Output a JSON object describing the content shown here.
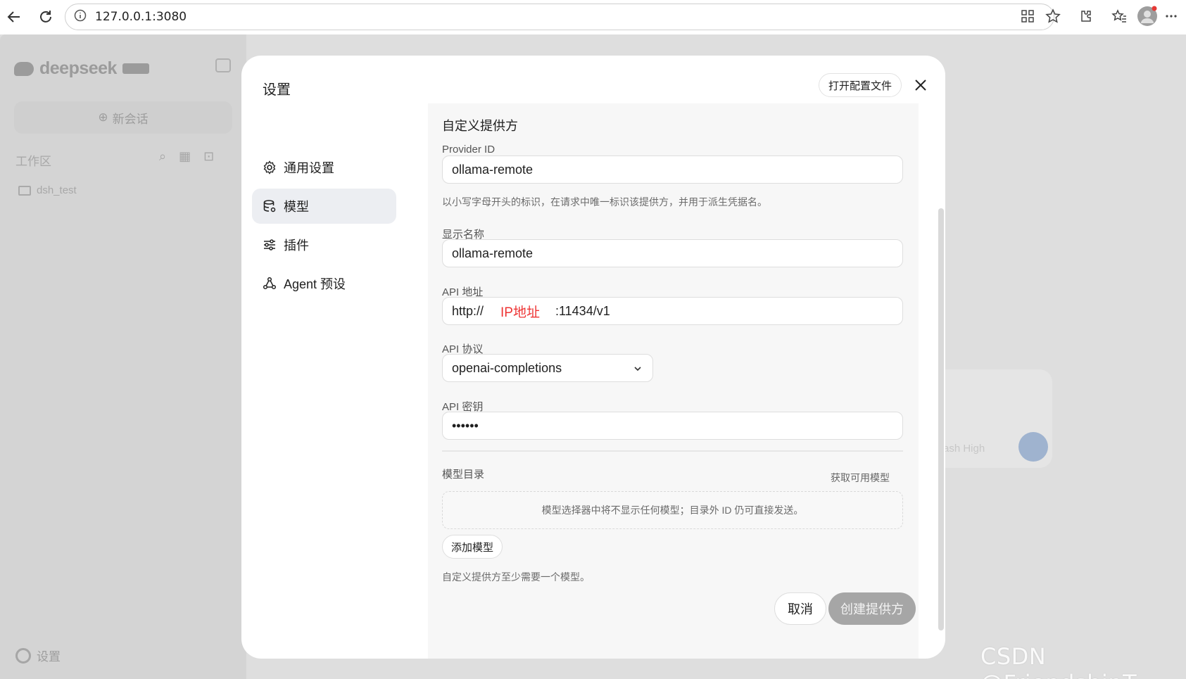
{
  "browser": {
    "url": "127.0.0.1:3080"
  },
  "background": {
    "logo_text": "deepseek",
    "new_chat_label": "新会话",
    "workspace_label": "工作区",
    "folder_name": "dsh_test",
    "settings_label": "设置",
    "composer_model_label": "ash High"
  },
  "modal": {
    "title": "设置",
    "open_config_label": "打开配置文件",
    "menu": [
      {
        "label": "通用设置",
        "icon": "gear-icon"
      },
      {
        "label": "模型",
        "icon": "database-icon"
      },
      {
        "label": "插件",
        "icon": "sliders-icon"
      },
      {
        "label": "Agent 预设",
        "icon": "agent-icon"
      }
    ],
    "active_menu_index": 1
  },
  "form": {
    "section_title": "自定义提供方",
    "provider_id_label": "Provider ID",
    "provider_id_value": "ollama-remote",
    "provider_id_help": "以小写字母开头的标识，在请求中唯一标识该提供方，并用于派生凭据名。",
    "display_name_label": "显示名称",
    "display_name_value": "ollama-remote",
    "api_address_label": "API 地址",
    "api_address_prefix": "http://",
    "api_address_annotation": "IP地址",
    "api_address_suffix": ":11434/v1",
    "api_protocol_label": "API 协议",
    "api_protocol_value": "openai-completions",
    "api_key_label": "API 密钥",
    "api_key_value": "••••••",
    "catalog_label": "模型目录",
    "fetch_models_label": "获取可用模型",
    "empty_catalog_text": "模型选择器中将不显示任何模型；目录外 ID 仍可直接发送。",
    "add_model_label": "添加模型",
    "catalog_help": "自定义提供方至少需要一个模型。",
    "cancel_label": "取消",
    "create_label": "创建提供方"
  },
  "watermark": "CSDN @FriendshipT"
}
